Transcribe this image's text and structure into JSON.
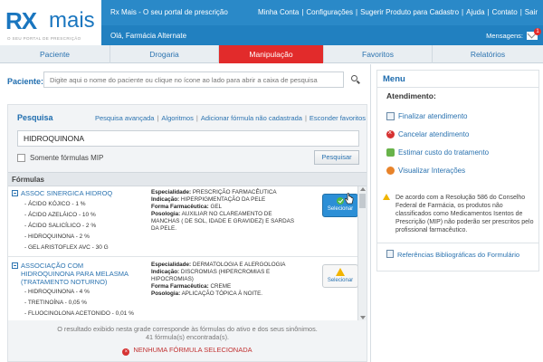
{
  "header": {
    "logo": {
      "rx": "RX",
      "mais": "mais",
      "tagline": "O SEU PORTAL DE PRESCRIÇÃO"
    },
    "title": "Rx Mais - O seu portal de prescrição",
    "links": [
      "Minha Conta",
      "Configurações",
      "Sugerir Produto para Cadastro",
      "Ajuda",
      "Contato",
      "Sair"
    ],
    "greeting": "Olá, Farmácia Alternate",
    "messages_label": "Mensagens:",
    "messages_count": "1"
  },
  "tabs": [
    {
      "label": "Paciente"
    },
    {
      "label": "Drogaria"
    },
    {
      "label": "Manipulação",
      "active": true
    },
    {
      "label": "Favoritos"
    },
    {
      "label": "Relatórios"
    }
  ],
  "patient": {
    "label": "Paciente:",
    "placeholder": "Digite aqui o nome do paciente ou clique no ícone ao lado para abrir a caixa de pesquisa"
  },
  "search": {
    "title": "Pesquisa",
    "links": [
      "Pesquisa avançada",
      "Algoritmos",
      "Adicionar fórmula não cadastrada",
      "Esconder favoritos"
    ],
    "query": "HIDROQUINONA",
    "mip_label": "Somente fórmulas MIP",
    "button": "Pesquisar"
  },
  "formulas": {
    "header": "Fórmulas",
    "items": [
      {
        "name": "ASSOC SINERGICA HIDROQ",
        "ingredients": [
          "- ÁCIDO KÓJICO - 1 %",
          "- ÁCIDO AZELÁICO - 10 %",
          "- ÁCIDO SALICÍLICO - 2 %",
          "- HIDROQUINONA - 2 %",
          "- GEL ARISTOFLEX AVC - 30 G"
        ],
        "especialidade": "PRESCRIÇÃO FARMACÊUTICA",
        "indicacao": "HIPERPIGMENTAÇÃO DA PELE",
        "forma": "GEL",
        "posologia": "AUXILIAR NO CLAREAMENTO DE MANCHAS ( DE SOL, IDADE E GRAVIDEZ) E SARDAS DA PELE.",
        "button": "Selecionar",
        "selected": true
      },
      {
        "name": "ASSOCIAÇÃO COM HIDROQUINONA PARA MELASMA (TRATAMENTO NOTURNO)",
        "ingredients": [
          "- HIDROQUINONA - 4 %",
          "- TRETINOÍNA - 0,05 %",
          "- FLUOCINOLONA ACETONIDO - 0,01 %"
        ],
        "especialidade": "DERMATOLOGIA E ALERGOLOGIA",
        "indicacao": "DISCROMIAS (HIPERCROMIAS E HIPOCROMIAS)",
        "forma": "CREME",
        "posologia": "APLICAÇÃO TÓPICA À NOITE.",
        "button": "Selecionar",
        "selected": false
      }
    ],
    "labels": {
      "especialidade": "Especialidade:",
      "indicacao": "Indicação:",
      "forma": "Forma Farmacêutica:",
      "posologia": "Posologia:"
    },
    "footnote_1": "O resultado exibido nesta grade corresponde às fórmulas do ativo e dos seus sinônimos.",
    "footnote_2": "41 fórmula(s) encontrada(s).",
    "none_selected": "NENHUMA FÓRMULA SELECIONADA"
  },
  "menu": {
    "title": "Menu",
    "section": "Atendimento:",
    "items": [
      {
        "label": "Finalizar atendimento",
        "icon": "document-icon"
      },
      {
        "label": "Cancelar atendimento",
        "icon": "cancel-icon"
      },
      {
        "label": "Estimar custo do tratamento",
        "icon": "money-icon"
      },
      {
        "label": "Visualizar Interações",
        "icon": "warning-circle-icon"
      }
    ],
    "notice": "De acordo com a Resolução 586 do Conselho Federal de Farmácia, os produtos não classificados como Medicamentos Isentos de Prescrição (MIP) não poderão ser prescritos pelo profissional farmacêutico.",
    "refs": "Referências Bibliográficas do Formulário"
  },
  "colors": {
    "brand_blue": "#2a89c8",
    "active_tab": "#e22b2b",
    "link": "#2b73b0",
    "select_button": "#2c8fd6"
  }
}
